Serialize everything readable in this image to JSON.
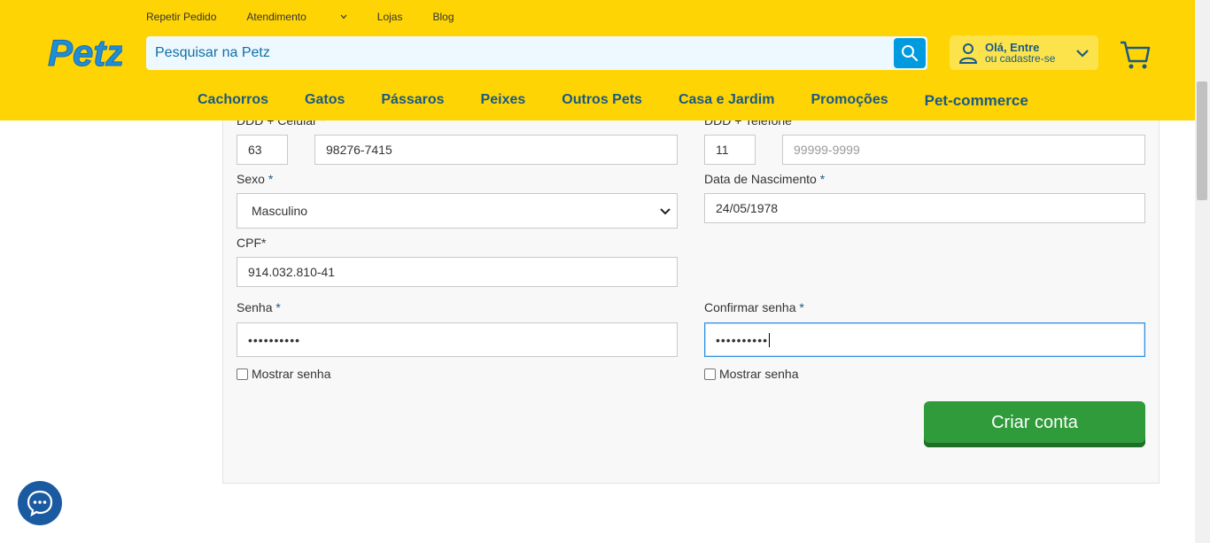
{
  "header": {
    "top_links": [
      {
        "label": "Repetir Pedido"
      },
      {
        "label": "Atendimento"
      },
      {
        "label": "Lojas"
      },
      {
        "label": "Blog"
      }
    ],
    "logo_text": "Petz",
    "search": {
      "placeholder": "Pesquisar na Petz",
      "value": ""
    },
    "account": {
      "title": "Olá, Entre",
      "subtitle": "ou cadastre-se"
    },
    "nav": [
      "Cachorros",
      "Gatos",
      "Pássaros",
      "Peixes",
      "Outros Pets",
      "Casa e Jardim",
      "Promoções",
      "Pet-commerce"
    ],
    "colors": {
      "background": "#fed404",
      "nav_text": "#1a5a86",
      "search_button": "#009bdf"
    }
  },
  "form": {
    "celular_label": "DDD + Celular",
    "celular_req": "*",
    "celular_ddd": "63",
    "celular_number": "98276-7415",
    "telefone_label": "DDD + Telefone",
    "telefone_ddd": "11",
    "telefone_placeholder": "99999-9999",
    "sexo_label": "Sexo",
    "sexo_req": "*",
    "sexo_value": "Masculino",
    "nascimento_label": "Data de Nascimento",
    "nascimento_req": "*",
    "nascimento_value": "24/05/1978",
    "cpf_label": "CPF*",
    "cpf_value": "914.032.810-41",
    "senha_label": "Senha",
    "senha_req": "*",
    "senha_value": "••••••••••",
    "confirmar_label": "Confirmar senha",
    "confirmar_req": "*",
    "confirmar_value": "••••••••••",
    "mostrar_senha": "Mostrar senha",
    "mostrar_senha_2": "Mostrar senha",
    "submit_label": "Criar conta",
    "colors": {
      "submit": "#2f9b3a",
      "focus_border": "#2f8fe0"
    }
  },
  "chat": {
    "icon": "chat-bubble-icon",
    "color": "#1a5aa0"
  }
}
